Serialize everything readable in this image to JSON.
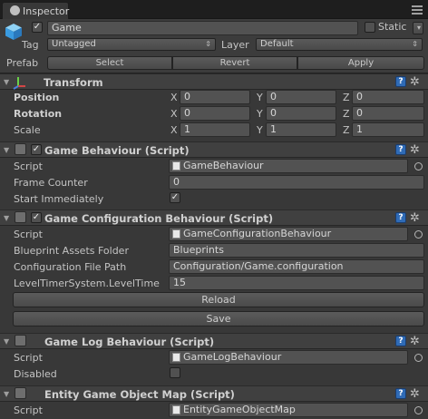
{
  "window": {
    "tab_title": "Inspector"
  },
  "gameobject": {
    "active": "✓",
    "name": "Game",
    "static_label": "Static",
    "tag_label": "Tag",
    "tag_value": "Untagged",
    "layer_label": "Layer",
    "layer_value": "Default",
    "prefab_label": "Prefab",
    "prefab_buttons": [
      "Select",
      "Revert",
      "Apply"
    ]
  },
  "transform": {
    "title": "Transform",
    "rows": [
      {
        "label": "Position",
        "x": "0",
        "y": "0",
        "z": "0"
      },
      {
        "label": "Rotation",
        "x": "0",
        "y": "0",
        "z": "0"
      },
      {
        "label": "Scale",
        "x": "1",
        "y": "1",
        "z": "1"
      }
    ],
    "axis": [
      "X",
      "Y",
      "Z"
    ]
  },
  "game_behaviour": {
    "title": "Game Behaviour (Script)",
    "script_label": "Script",
    "script_value": "GameBehaviour",
    "frame_counter_label": "Frame Counter",
    "frame_counter_value": "0",
    "start_immediately_label": "Start Immediately",
    "start_immediately_check": "✓"
  },
  "game_config": {
    "title": "Game Configuration Behaviour (Script)",
    "script_label": "Script",
    "script_value": "GameConfigurationBehaviour",
    "blueprint_label": "Blueprint Assets Folder",
    "blueprint_value": "Blueprints",
    "config_label": "Configuration File Path",
    "config_value": "Configuration/Game.configuration",
    "level_timer_label": "LevelTimerSystem.LevelTime",
    "level_timer_value": "15",
    "reload_label": "Reload",
    "save_label": "Save"
  },
  "game_log": {
    "title": "Game Log Behaviour (Script)",
    "script_label": "Script",
    "script_value": "GameLogBehaviour",
    "disabled_label": "Disabled"
  },
  "entity_map": {
    "title": "Entity Game Object Map (Script)",
    "script_label": "Script",
    "script_value": "EntityGameObjectMap"
  },
  "icons": {
    "help": "?",
    "gear": "✲",
    "fold": "▼"
  },
  "colors": {
    "background": "#383838",
    "help_icon": "#2f6bb6"
  }
}
